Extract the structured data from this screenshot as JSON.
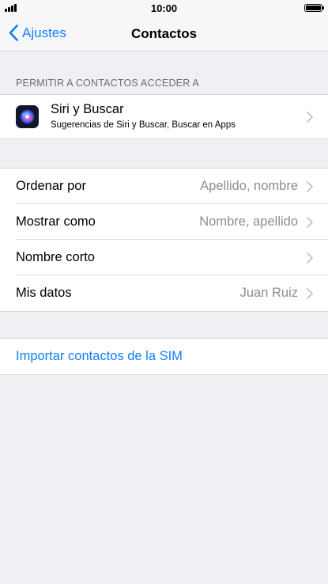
{
  "status_bar": {
    "time": "10:00",
    "battery_level": 1.0
  },
  "nav": {
    "back_label": "Ajustes",
    "title": "Contactos"
  },
  "allow_section": {
    "header": "PERMITIR A CONTACTOS ACCEDER A",
    "siri": {
      "title": "Siri y Buscar",
      "subtitle": "Sugerencias de Siri y Buscar, Buscar en Apps"
    }
  },
  "settings": {
    "rows": [
      {
        "label": "Ordenar por",
        "value": "Apellido, nombre"
      },
      {
        "label": "Mostrar como",
        "value": "Nombre, apellido"
      },
      {
        "label": "Nombre corto",
        "value": ""
      },
      {
        "label": "Mis datos",
        "value": "Juan Ruiz"
      }
    ]
  },
  "import": {
    "label": "Importar contactos de la SIM"
  },
  "colors": {
    "accent": "#147efb",
    "background": "#efeff4",
    "secondary_text": "#8e8e93"
  }
}
